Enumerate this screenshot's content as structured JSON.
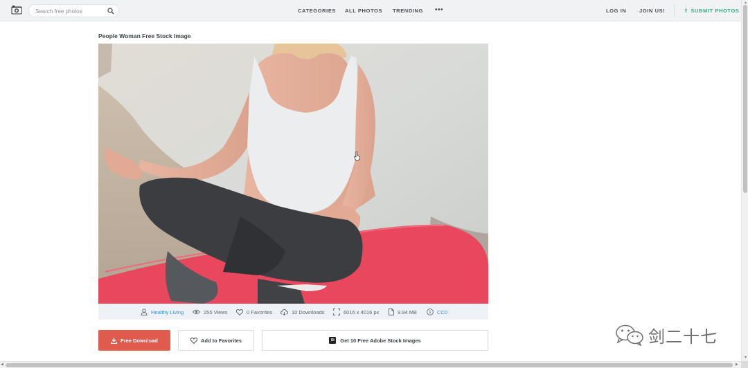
{
  "header": {
    "search_placeholder": "Search free photos",
    "nav": {
      "categories": "CATEGORIES",
      "all_photos": "ALL PHOTOS",
      "trending": "TRENDING",
      "more": "•••"
    },
    "login": "LOG IN",
    "join": "JOIN US!",
    "submit": "SUBMIT PHOTOS",
    "icons": [
      "camera-icon",
      "search-icon",
      "upload-icon"
    ]
  },
  "photo": {
    "title": "People Woman Free Stock Image",
    "meta": {
      "category": "Healthy Living",
      "views": "255 Views",
      "favorites": "0 Favorites",
      "downloads": "10 Downloads",
      "dimensions": "6016 x 4016 px",
      "file_size": "9.94 MB",
      "license": "CC0"
    }
  },
  "actions": {
    "free_download": "Free Download",
    "add_to_favorites": "Add to Favorites",
    "adobe_stock": "Get 10 Free Adobe Stock Images",
    "adobe_badge": "St"
  },
  "watermark": {
    "text": "剑二十七"
  },
  "colors": {
    "download_button": "#e05a4e",
    "submit_accent": "#3fa788",
    "link": "#3d8fd6",
    "topbar": "#f1f2f4",
    "meta_bar": "#eef2f6"
  }
}
